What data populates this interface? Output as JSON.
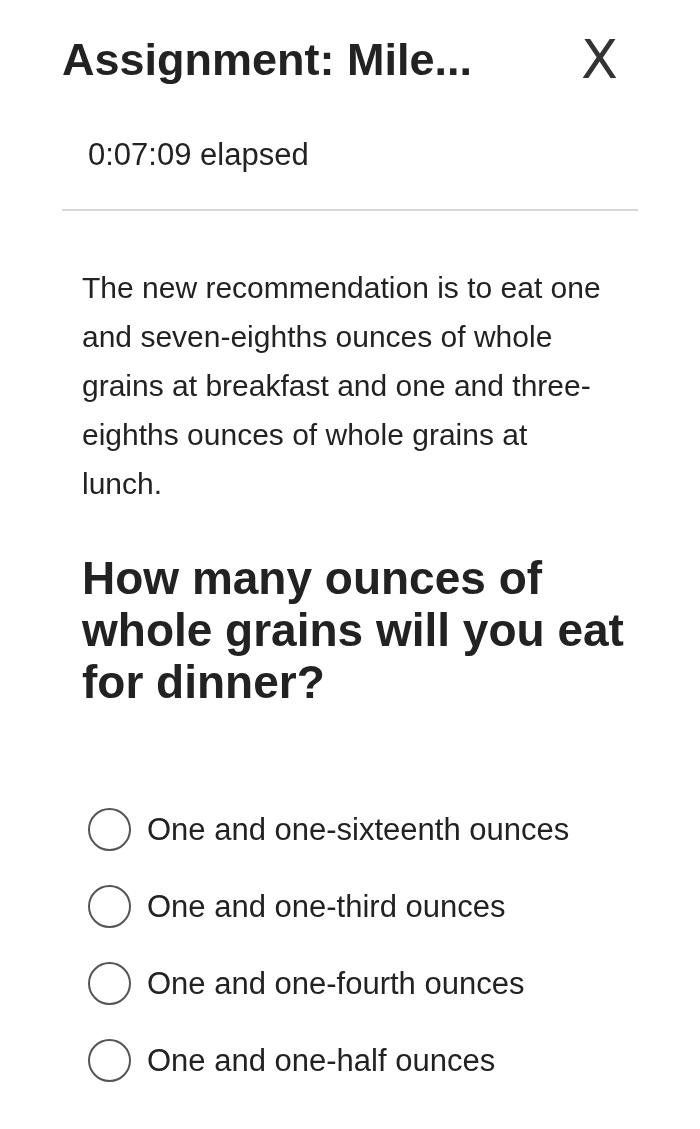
{
  "header": {
    "title": "Assignment: Mile...",
    "close": "X"
  },
  "timer": {
    "elapsed": "0:07:09 elapsed"
  },
  "question": {
    "passage": "The new recommendation is to eat one and seven-eighths ounces of whole grains at breakfast and one and three-eighths ounces of whole grains at lunch.",
    "prompt": "How many ounces of whole grains will you eat for dinner?"
  },
  "options": [
    {
      "label": "One and one-sixteenth ounces",
      "selected": false
    },
    {
      "label": "One and one-third ounces",
      "selected": false
    },
    {
      "label": "One and one-fourth ounces",
      "selected": false
    },
    {
      "label": "One and one-half ounces",
      "selected": false
    }
  ]
}
